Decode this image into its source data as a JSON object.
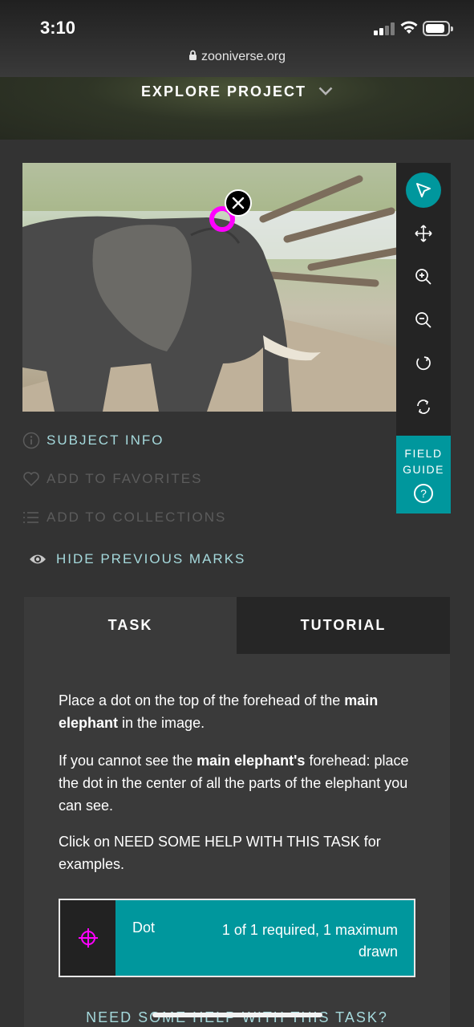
{
  "status_bar": {
    "time": "3:10"
  },
  "browser": {
    "url": "zooniverse.org"
  },
  "header": {
    "explore_label": "EXPLORE PROJECT"
  },
  "tools": [
    {
      "name": "pointer-icon",
      "active": true
    },
    {
      "name": "move-icon"
    },
    {
      "name": "zoom-in-icon"
    },
    {
      "name": "zoom-out-icon"
    },
    {
      "name": "rotate-icon"
    },
    {
      "name": "reset-icon"
    }
  ],
  "field_guide": {
    "line1": "FIELD",
    "line2": "GUIDE",
    "icon": "?"
  },
  "meta": {
    "subject_info": "SUBJECT INFO",
    "favorites": "ADD TO FAVORITES",
    "collections": "ADD TO COLLECTIONS",
    "hide_marks": "HIDE PREVIOUS MARKS"
  },
  "tabs": {
    "task": "TASK",
    "tutorial": "TUTORIAL"
  },
  "instructions": {
    "p1_a": "Place a dot on the top of the forehead of the ",
    "p1_bold": "main elephant",
    "p1_b": " in the image.",
    "p2_a": "If you cannot see the ",
    "p2_bold": "main elephant's",
    "p2_b": " forehead: place the dot in the center of all the parts of the elephant you can see.",
    "p3": "Click on NEED SOME HELP WITH THIS TASK for examples."
  },
  "answer": {
    "label": "Dot",
    "count": "1 of 1 required, 1 maximum drawn",
    "icon": "crosshair-icon"
  },
  "help_link": "NEED SOME HELP WITH THIS TASK?",
  "colors": {
    "accent": "#00979d",
    "mark": "#ff00ff",
    "link": "#a5d9dc"
  }
}
